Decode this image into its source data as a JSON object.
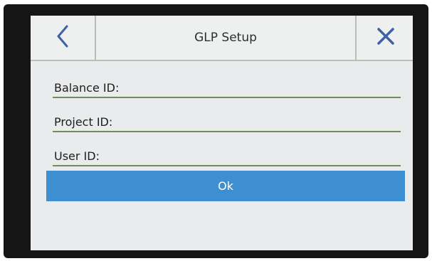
{
  "header": {
    "title": "GLP Setup",
    "back_icon": "chevron-left-icon",
    "close_icon": "close-icon"
  },
  "fields": [
    {
      "label": "Balance ID:",
      "value": ""
    },
    {
      "label": "Project ID:",
      "value": ""
    },
    {
      "label": "User ID:",
      "value": ""
    }
  ],
  "ok_label": "Ok",
  "colors": {
    "accent": "#3d8fd1",
    "icon": "#3f5fa6",
    "underline": "#6f8c5a"
  }
}
